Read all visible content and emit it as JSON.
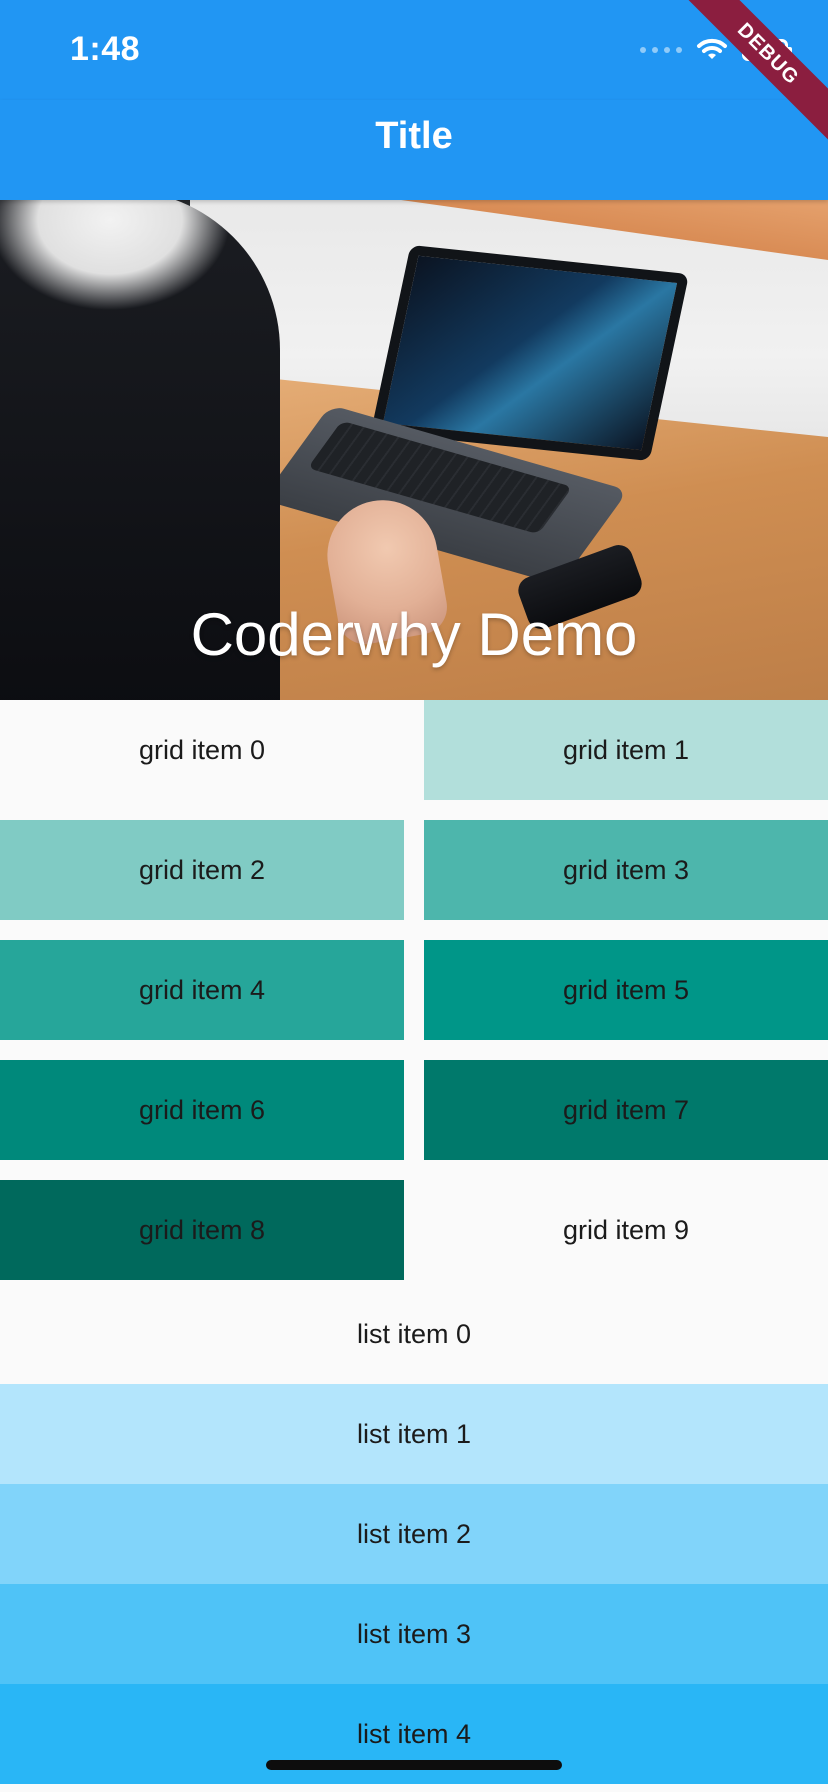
{
  "status_bar": {
    "time": "1:48",
    "icons": [
      "signal-dots-icon",
      "wifi-icon",
      "battery-icon"
    ]
  },
  "app_bar": {
    "title": "Title",
    "background": "#2196f3"
  },
  "debug_ribbon": {
    "label": "DEBUG",
    "color": "#8b1e3f"
  },
  "hero": {
    "title": "Coderwhy Demo"
  },
  "grid": {
    "items": [
      {
        "label": "grid item 0",
        "color": "#fafafa"
      },
      {
        "label": "grid item 1",
        "color": "#b2dfdb"
      },
      {
        "label": "grid item 2",
        "color": "#80cbc4"
      },
      {
        "label": "grid item 3",
        "color": "#4db6ac"
      },
      {
        "label": "grid item 4",
        "color": "#26a69a"
      },
      {
        "label": "grid item 5",
        "color": "#009688"
      },
      {
        "label": "grid item 6",
        "color": "#00897b"
      },
      {
        "label": "grid item 7",
        "color": "#00796b"
      },
      {
        "label": "grid item 8",
        "color": "#00695c"
      },
      {
        "label": "grid item 9",
        "color": "#fafafa"
      }
    ]
  },
  "list": {
    "items": [
      {
        "label": "list item 0",
        "color": "#fafafa"
      },
      {
        "label": "list item 1",
        "color": "#b3e5fc"
      },
      {
        "label": "list item 2",
        "color": "#81d4fa"
      },
      {
        "label": "list item 3",
        "color": "#4fc3f7"
      },
      {
        "label": "list item 4",
        "color": "#29b6f6"
      }
    ]
  }
}
